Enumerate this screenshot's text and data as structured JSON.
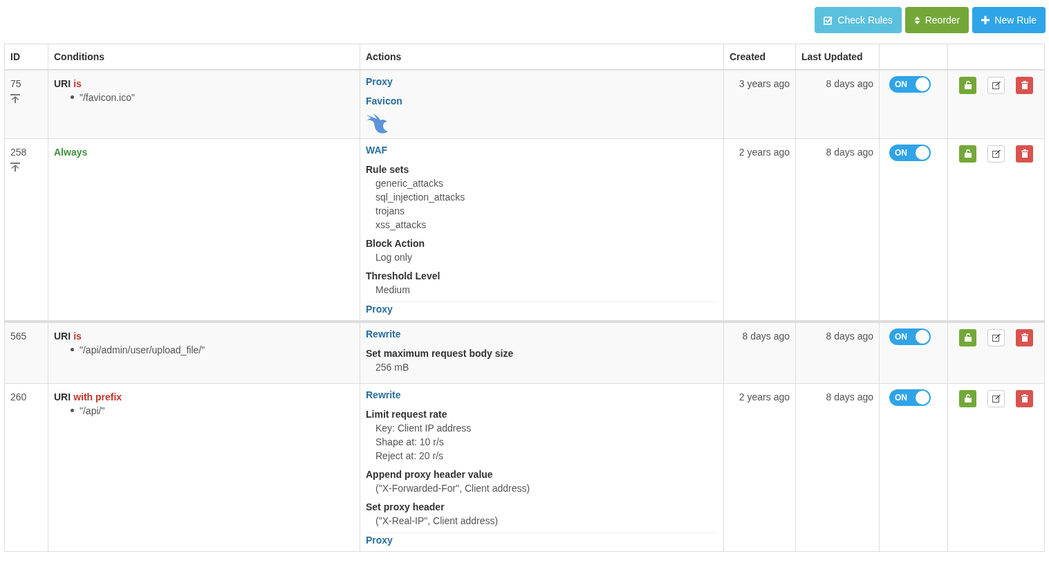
{
  "toolbar": [
    {
      "kind": "check",
      "label": "Check Rules"
    },
    {
      "kind": "reorder",
      "label": "Reorder"
    },
    {
      "kind": "new",
      "label": "New Rule"
    }
  ],
  "table": {
    "columns": [
      "ID",
      "Conditions",
      "Actions",
      "Created",
      "Last Updated"
    ],
    "rows": [
      {
        "id": "75",
        "pinned": true,
        "group_end": false,
        "condition": {
          "kind": "match",
          "subject": "URI",
          "operator": "is",
          "values": [
            "\"/favicon.ico\""
          ]
        },
        "actions": [
          {
            "kind": "title",
            "text": "Proxy"
          },
          {
            "kind": "title",
            "text": "Favicon"
          },
          {
            "kind": "logo"
          }
        ],
        "created": "3 years ago",
        "updated": "8 days ago",
        "toggle": {
          "on": true,
          "label": "ON"
        }
      },
      {
        "id": "258",
        "pinned": true,
        "group_end": true,
        "condition": {
          "kind": "always",
          "text": "Always"
        },
        "actions": [
          {
            "kind": "title",
            "text": "WAF"
          },
          {
            "kind": "param",
            "heading": "Rule sets",
            "lines": [
              "generic_attacks",
              "sql_injection_attacks",
              "trojans",
              "xss_attacks"
            ]
          },
          {
            "kind": "param",
            "heading": "Block Action",
            "lines": [
              "Log only"
            ]
          },
          {
            "kind": "param",
            "heading": "Threshold Level",
            "lines": [
              "Medium"
            ]
          },
          {
            "kind": "final",
            "text": "Proxy"
          }
        ],
        "created": "2 years ago",
        "updated": "8 days ago",
        "toggle": {
          "on": true,
          "label": "ON"
        }
      },
      {
        "id": "565",
        "pinned": false,
        "group_end": false,
        "condition": {
          "kind": "match",
          "subject": "URI",
          "operator": "is",
          "values": [
            "\"/api/admin/user/upload_file/\""
          ]
        },
        "actions": [
          {
            "kind": "title",
            "text": "Rewrite"
          },
          {
            "kind": "param",
            "heading": "Set maximum request body size",
            "lines": [
              "256 mB"
            ]
          }
        ],
        "created": "8 days ago",
        "updated": "8 days ago",
        "toggle": {
          "on": true,
          "label": "ON"
        }
      },
      {
        "id": "260",
        "pinned": false,
        "group_end": false,
        "condition": {
          "kind": "match",
          "subject": "URI",
          "operator": "with prefix",
          "values": [
            "\"/api/\""
          ]
        },
        "actions": [
          {
            "kind": "title",
            "text": "Rewrite"
          },
          {
            "kind": "param",
            "heading": "Limit request rate",
            "lines": [
              "Key: Client IP address",
              "Shape at: 10 r/s",
              "Reject at: 20 r/s"
            ]
          },
          {
            "kind": "param",
            "heading": "Append proxy header value",
            "lines": [
              "(\"X-Forwarded-For\", Client address)"
            ]
          },
          {
            "kind": "param",
            "heading": "Set proxy header",
            "lines": [
              "(\"X-Real-IP\", Client address)"
            ]
          },
          {
            "kind": "final",
            "text": "Proxy"
          }
        ],
        "created": "2 years ago",
        "updated": "8 days ago",
        "toggle": {
          "on": true,
          "label": "ON"
        }
      }
    ]
  }
}
